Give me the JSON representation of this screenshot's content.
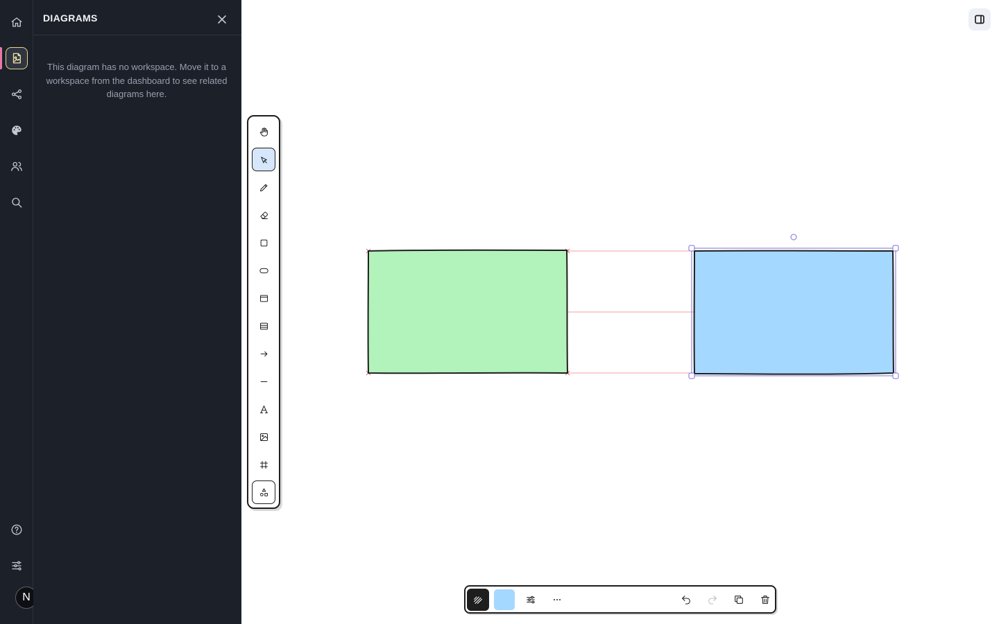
{
  "rail": {
    "items": [
      {
        "name": "home",
        "icon": "home-icon"
      },
      {
        "name": "diagrams",
        "icon": "diagram-file-icon",
        "active": true
      },
      {
        "name": "share",
        "icon": "share-icon"
      },
      {
        "name": "theme",
        "icon": "palette-icon"
      },
      {
        "name": "collaborators",
        "icon": "users-icon"
      },
      {
        "name": "search",
        "icon": "search-icon"
      },
      {
        "name": "help",
        "icon": "help-circle-icon"
      },
      {
        "name": "settings",
        "icon": "sliders-icon"
      }
    ],
    "avatar_initial": "N",
    "active_indicator_color": "#e879a6"
  },
  "panel": {
    "title": "DIAGRAMS",
    "message": "This diagram has no workspace. Move it to a workspace from the dashboard to see related diagrams here."
  },
  "toolbox": {
    "tools": [
      {
        "name": "hand",
        "icon": "hand-icon"
      },
      {
        "name": "select",
        "icon": "pointer-icon",
        "selected": true
      },
      {
        "name": "pencil",
        "icon": "pencil-icon"
      },
      {
        "name": "eraser",
        "icon": "eraser-icon"
      },
      {
        "name": "rectangle",
        "icon": "square-icon"
      },
      {
        "name": "rounded",
        "icon": "pill-icon"
      },
      {
        "name": "frame",
        "icon": "window-icon"
      },
      {
        "name": "table",
        "icon": "table-icon"
      },
      {
        "name": "arrow",
        "icon": "arrow-right-icon"
      },
      {
        "name": "line",
        "icon": "line-icon"
      },
      {
        "name": "text",
        "icon": "text-icon"
      },
      {
        "name": "image",
        "icon": "image-icon"
      },
      {
        "name": "frame-hash",
        "icon": "hash-icon"
      },
      {
        "name": "shapes",
        "icon": "shapes-icon"
      }
    ]
  },
  "canvas": {
    "shapes": [
      {
        "name": "green-rectangle",
        "fill": "#b2f2bb",
        "stroke": "#1e1e1e",
        "selected": false
      },
      {
        "name": "blue-rectangle",
        "fill": "#a5d8ff",
        "stroke": "#1e1e1e",
        "selected": true
      }
    ],
    "guide_color": "#f4a0a0",
    "selection_color": "#7b6fd6"
  },
  "bottom_bar": {
    "current_fill": "#a5d8ff",
    "buttons": [
      {
        "name": "stroke-style",
        "icon": "hatch-icon"
      },
      {
        "name": "fill-color",
        "icon": "swatch"
      },
      {
        "name": "properties",
        "icon": "sliders-icon"
      },
      {
        "name": "more",
        "icon": "ellipsis-icon"
      },
      {
        "name": "undo",
        "icon": "undo-icon"
      },
      {
        "name": "redo",
        "icon": "redo-icon",
        "disabled": true
      },
      {
        "name": "duplicate",
        "icon": "copy-icon"
      },
      {
        "name": "delete",
        "icon": "trash-icon"
      }
    ]
  }
}
